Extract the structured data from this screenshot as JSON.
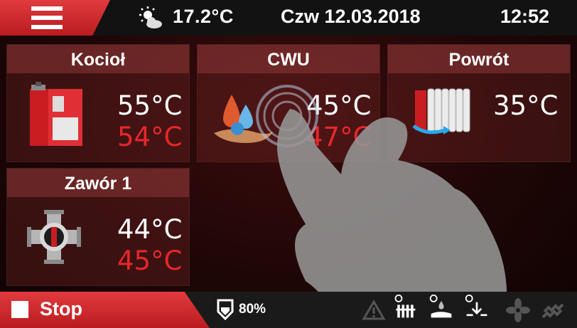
{
  "topbar": {
    "menu_icon": "hamburger-menu-icon",
    "weather_icon": "sun-cloud-icon",
    "outdoor_temp": "17.2°C",
    "date": "Czw 12.03.2018",
    "time": "12:52"
  },
  "tiles": {
    "kociol": {
      "title": "Kocioł",
      "icon": "boiler-icon",
      "value": "55°C",
      "setpoint": "54°C"
    },
    "cwu": {
      "title": "CWU",
      "icon": "hot-water-drops-icon",
      "value": "45°C",
      "setpoint": "47°C"
    },
    "powrot": {
      "title": "Powrót",
      "icon": "radiator-return-icon",
      "value": "35°C"
    },
    "zawor1": {
      "title": "Zawór 1",
      "icon": "four-way-valve-icon",
      "value": "44°C",
      "setpoint": "45°C"
    }
  },
  "bottombar": {
    "stop_label": "Stop",
    "fuel_icon": "fuel-hopper-icon",
    "fuel_level": "80%",
    "status_icons": [
      "warning-icon",
      "radiator-pump-icon",
      "hot-water-pump-icon",
      "feeder-icon",
      "fan-icon",
      "auger-icon"
    ]
  },
  "colors": {
    "accent_red": "#d12a2e",
    "setpoint_red": "#e8262a",
    "bar_dark": "#121212"
  }
}
